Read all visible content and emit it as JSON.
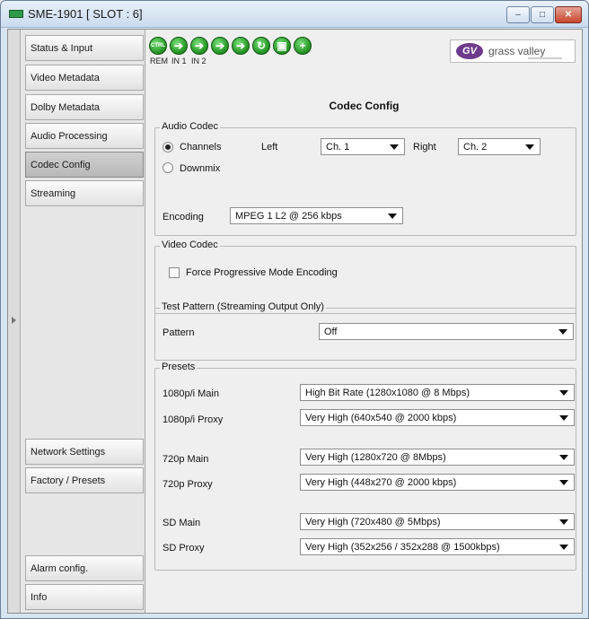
{
  "window": {
    "title": "SME-1901 [ SLOT : 6]",
    "minimize_glyph": "–",
    "maximize_glyph": "□",
    "close_glyph": "✕"
  },
  "sidebar": {
    "items": [
      {
        "label": "Status & Input",
        "active": false
      },
      {
        "label": "Video Metadata",
        "active": false
      },
      {
        "label": "Dolby Metadata",
        "active": false
      },
      {
        "label": "Audio Processing",
        "active": false
      },
      {
        "label": "Codec Config",
        "active": true
      },
      {
        "label": "Streaming",
        "active": false
      },
      {
        "label": "Network Settings",
        "active": false
      },
      {
        "label": "Factory / Presets",
        "active": false
      },
      {
        "label": "Alarm config.",
        "active": false
      },
      {
        "label": "Info",
        "active": false
      }
    ]
  },
  "card_status": {
    "ctrl_text": "CTRL",
    "labels": [
      "REM",
      "IN 1",
      "IN 2"
    ],
    "icons": [
      "ctrl-status-icon",
      "arrow-right-icon",
      "arrow-right-icon",
      "arrow-right-icon",
      "arrow-right-icon",
      "loop-icon",
      "module-icon",
      "plus-icon"
    ]
  },
  "logo": {
    "mark": "GV",
    "text": "grass valley"
  },
  "page": {
    "title": "Codec Config"
  },
  "audio_codec": {
    "title": "Audio Codec",
    "channels_label": "Channels",
    "downmix_label": "Downmix",
    "selected_mode": "Channels",
    "left_label": "Left",
    "left_value": "Ch. 1",
    "right_label": "Right",
    "right_value": "Ch. 2",
    "encoding_label": "Encoding",
    "encoding_value": "MPEG 1 L2 @ 256 kbps"
  },
  "video_codec": {
    "title": "Video Codec",
    "force_progressive_label": "Force Progressive Mode Encoding",
    "force_progressive_checked": false
  },
  "test_pattern": {
    "title": "Test Pattern (Streaming Output Only)",
    "pattern_label": "Pattern",
    "pattern_value": "Off"
  },
  "presets": {
    "title": "Presets",
    "rows": [
      {
        "label": "1080p/i Main",
        "value": "High Bit Rate (1280x1080 @ 8 Mbps)"
      },
      {
        "label": "1080p/i Proxy",
        "value": "Very High (640x540 @ 2000 kbps)"
      },
      {
        "label": "720p Main",
        "value": "Very High (1280x720 @ 8Mbps)"
      },
      {
        "label": "720p Proxy",
        "value": "Very High (448x270 @ 2000 kbps)"
      },
      {
        "label": "SD Main",
        "value": "Very High (720x480 @ 5Mbps)"
      },
      {
        "label": "SD Proxy",
        "value": "Very High (352x256 / 352x288 @ 1500kbps)"
      }
    ]
  },
  "colors": {
    "titlebar": "#c9dbef",
    "status_green": "#2a9c2a",
    "logo_purple": "#6e3a8c",
    "close_red": "#c7452d"
  }
}
